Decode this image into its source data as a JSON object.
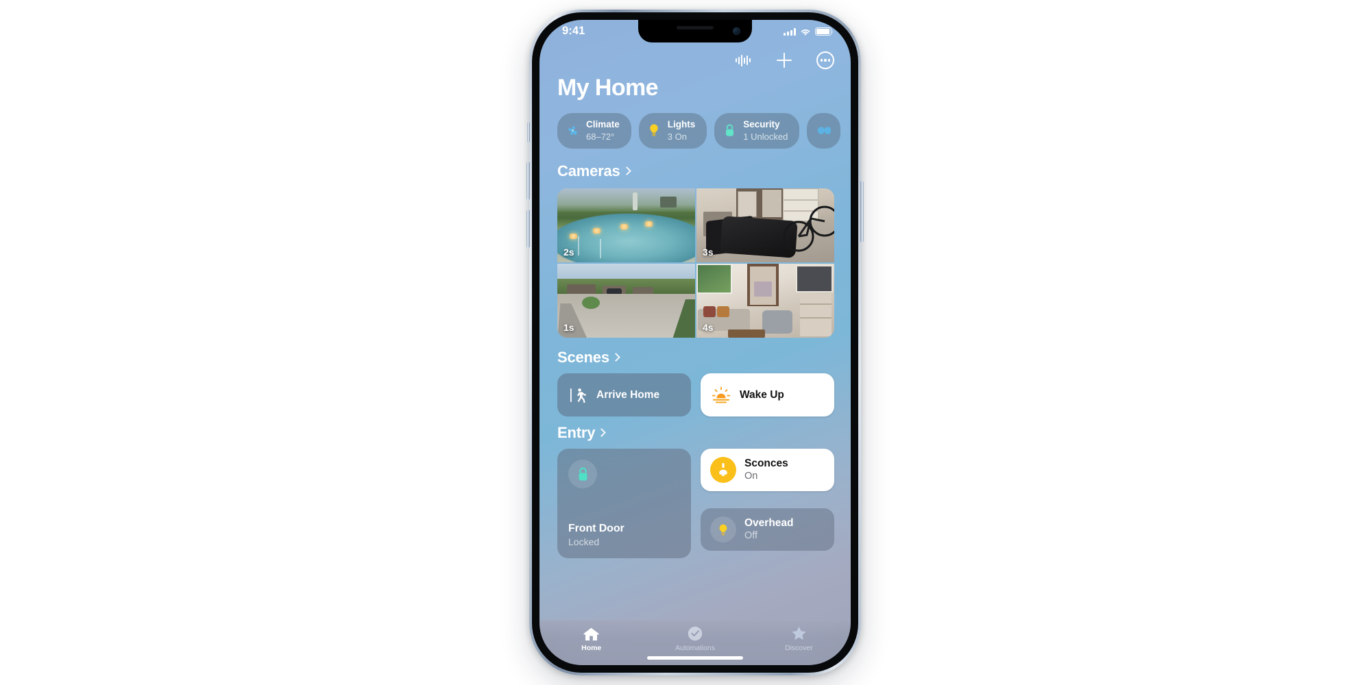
{
  "status_bar": {
    "time": "9:41",
    "cellular_icon": "cellular-bars-icon",
    "wifi_icon": "wifi-icon",
    "battery_icon": "battery-full-icon"
  },
  "toolbar": {
    "buttons": [
      {
        "name": "audio-waveform-button",
        "icon": "waveform-icon"
      },
      {
        "name": "add-button",
        "icon": "plus-icon"
      },
      {
        "name": "more-options-button",
        "icon": "ellipsis-circle-icon"
      }
    ]
  },
  "header": {
    "title": "My Home"
  },
  "status_pills": [
    {
      "title": "Climate",
      "subtitle": "68–72°",
      "icon": "fan-icon",
      "color": "#5ab6e8"
    },
    {
      "title": "Lights",
      "subtitle": "3 On",
      "icon": "lightbulb-icon",
      "color": "#fbd024"
    },
    {
      "title": "Security",
      "subtitle": "1 Unlocked",
      "icon": "lock-icon",
      "color": "#62e4c8"
    },
    {
      "title": "",
      "subtitle": "",
      "icon": "more-pill-icon",
      "color": "#5ab6e8"
    }
  ],
  "sections": {
    "cameras": {
      "title": "Cameras",
      "chevron": "chevron-right-icon",
      "tiles": [
        {
          "name": "camera-pool",
          "timestamp": "2s"
        },
        {
          "name": "camera-garage",
          "timestamp": "3s"
        },
        {
          "name": "camera-driveway",
          "timestamp": "1s"
        },
        {
          "name": "camera-living-room",
          "timestamp": "4s"
        }
      ]
    },
    "scenes": {
      "title": "Scenes",
      "chevron": "chevron-right-icon",
      "items": [
        {
          "label": "Arrive Home",
          "icon": "person-walking-door-icon",
          "state": "inactive"
        },
        {
          "label": "Wake Up",
          "icon": "sunrise-icon",
          "state": "active"
        }
      ]
    },
    "entry": {
      "title": "Entry",
      "chevron": "chevron-right-icon",
      "door": {
        "name": "Front Door",
        "state": "Locked",
        "icon": "lock-closed-icon",
        "accent": "#4fe0c6"
      },
      "lights": [
        {
          "name": "Sconces",
          "state": "On",
          "icon": "sconce-lamp-icon",
          "active": true
        },
        {
          "name": "Overhead",
          "state": "Off",
          "icon": "ceiling-light-icon",
          "active": false
        }
      ]
    }
  },
  "tab_bar": {
    "tabs": [
      {
        "label": "Home",
        "icon": "house-icon",
        "active": true
      },
      {
        "label": "Automations",
        "icon": "clock-check-icon",
        "active": false
      },
      {
        "label": "Discover",
        "icon": "star-icon",
        "active": false
      }
    ]
  }
}
